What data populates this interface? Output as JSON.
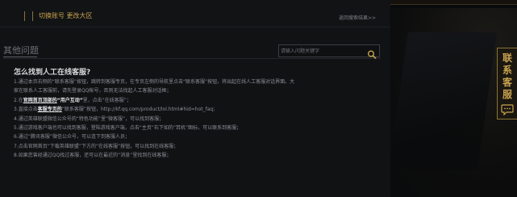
{
  "topbar": {
    "account_link": "切换账号 更改大区",
    "back_link": "返回搜索结果>>"
  },
  "main": {
    "section_title": "其他问题",
    "search": {
      "placeholder": "请输入问题关键字",
      "icon": "search-icon"
    },
    "faq": {
      "heading": "怎么找到人工在线客服?",
      "lines": [
        {
          "parts": [
            {
              "text": "1.通过本页右侧的“联系客服”按钮，跳转到客服专页，在专页左侧的导航里点击“联系客服”按钮，将出起在线人工客服对话界面。大"
            }
          ]
        },
        {
          "parts": [
            {
              "text": "家在联系人工客服前，请先登录QQ帐号，否则无法找起人工客服对话框；"
            }
          ]
        },
        {
          "parts": [
            {
              "text": "2.在"
            },
            {
              "text": "官网首页顶部的",
              "style": "hl ul"
            },
            {
              "text": "“用户互动”",
              "style": "hl"
            },
            {
              "text": "里，点击“在线客服”；"
            }
          ]
        },
        {
          "parts": [
            {
              "text": "3.直接点击"
            },
            {
              "text": "客服专页的",
              "style": "hl ul"
            },
            {
              "text": "“联系客服”按钮，http://kf.qq.com/product/lol.html#hid=hot_faq;"
            }
          ]
        },
        {
          "parts": [
            {
              "text": "4.通过英雄联盟微信公众号的“特色功能”里“微客服”，可以找到客服；"
            }
          ]
        },
        {
          "parts": [
            {
              "text": "5.通过游戏客户端也可以找到客服，登陆游戏客户端，点击“主页”右下如的“耳机”图标，可以联系到客服；"
            }
          ]
        },
        {
          "parts": [
            {
              "text": "6.通过“腾讯客服”微信公众号，可以连下到客服人员；"
            }
          ]
        },
        {
          "parts": [
            {
              "text": "7.点击官网首页“下载英雄联盟”下方的“在线客服”按钮，可以找到在线客服；"
            }
          ]
        },
        {
          "parts": [
            {
              "text": "8.如果您曾经通过QQ找过客服，还可以在最近的“消息”里找到在线客服；"
            }
          ]
        }
      ]
    }
  },
  "contact_tab": {
    "label": "联系客服",
    "icon": "chat-bubble-icon"
  },
  "colors": {
    "accent_gold": "#c9a24f",
    "background": "#111214"
  }
}
